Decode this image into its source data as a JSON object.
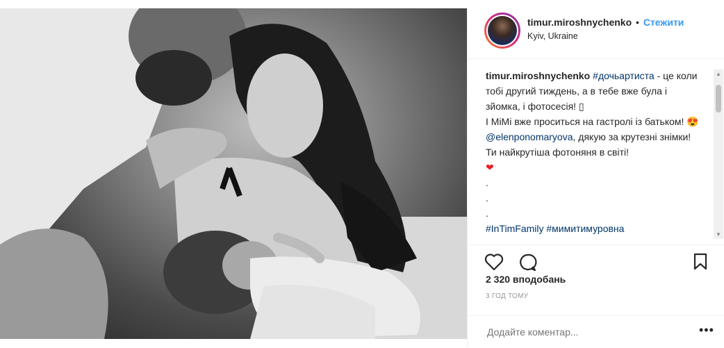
{
  "post": {
    "username": "timur.miroshnychenko",
    "follow_label": "Стежити",
    "location": "Kyiv, Ukraine",
    "caption_user": "timur.miroshnychenko",
    "caption_hashtag1": "#дочьартиста",
    "caption_text1": " - це коли тобі другий тиждень, а в тебе вже була і зйомка, і фотосесія! ",
    "caption_text2": "І МіМі вже проситься на гастролі із батьком! ",
    "caption_mention": "@elenponomaryova",
    "caption_text3": ", дякую за крутезні знімки! Ти найкрутіша фотоняня в світі!",
    "caption_dots": ".\n.\n.",
    "caption_hashtags2": "#InTimFamily",
    "caption_hashtags3": "#мимитимуровна",
    "likes": "2 320 вподобань",
    "time": "3 год тому",
    "comment_placeholder": "Додайте коментар...",
    "more_label": "•••"
  },
  "icons": {
    "like": "heart-outline-icon",
    "comment": "comment-bubble-icon",
    "save": "bookmark-icon",
    "emoji_love": "heart-eyes-emoji",
    "emoji_heart": "red-heart-emoji"
  },
  "colors": {
    "link": "#003569",
    "follow": "#3897f0",
    "border": "#efefef"
  }
}
